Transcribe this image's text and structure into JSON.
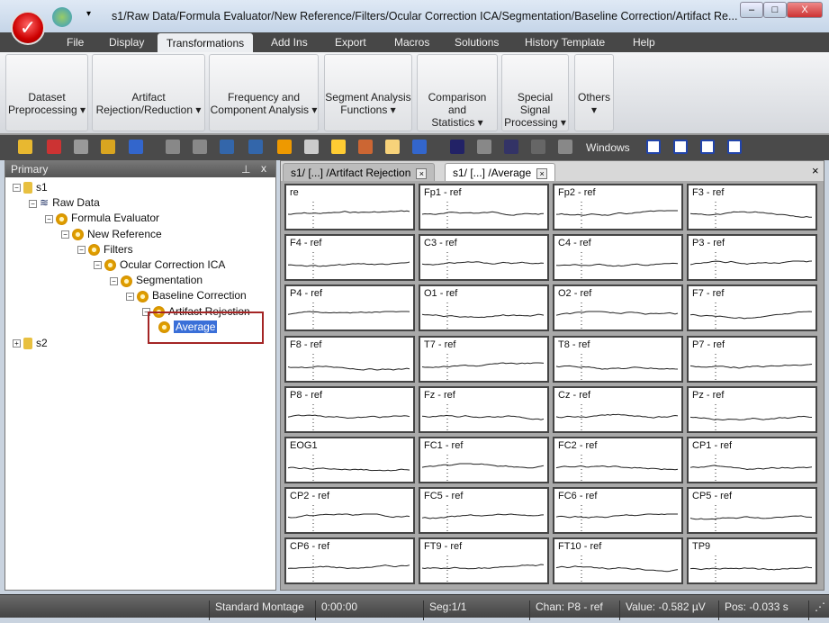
{
  "window": {
    "title": "s1/Raw Data/Formula Evaluator/New Reference/Filters/Ocular Correction ICA/Segmentation/Baseline Correction/Artifact Re...",
    "minimize": "–",
    "restore": "□",
    "close": "X"
  },
  "menu": [
    "File",
    "Display",
    "Transformations",
    "Add Ins",
    "Export",
    "Macros",
    "Solutions",
    "History Template",
    "Help"
  ],
  "active_menu": "Transformations",
  "ribbon": [
    {
      "l1": "Dataset",
      "l2": "Preprocessing ▾"
    },
    {
      "l1": "Artifact",
      "l2": "Rejection/Reduction ▾"
    },
    {
      "l1": "Frequency and",
      "l2": "Component Analysis ▾"
    },
    {
      "l1": "Segment Analysis",
      "l2": "Functions ▾"
    },
    {
      "l1": "Comparison and",
      "l2": "Statistics ▾"
    },
    {
      "l1": "Special Signal",
      "l2": "Processing ▾"
    },
    {
      "l1": "Others",
      "l2": "▾"
    }
  ],
  "toolbar": {
    "windows_label": "Windows"
  },
  "left_pane": {
    "title": "Primary",
    "pin": "⊥",
    "close": "x",
    "tree": [
      {
        "label": "s1",
        "level": 0,
        "icon": "folder-icon"
      },
      {
        "label": "Raw Data",
        "level": 1,
        "icon": "waves-icon"
      },
      {
        "label": "Formula Evaluator",
        "level": 2,
        "icon": "gear-icon"
      },
      {
        "label": "New Reference",
        "level": 3,
        "icon": "gear-icon"
      },
      {
        "label": "Filters",
        "level": 4,
        "icon": "gear-icon"
      },
      {
        "label": "Ocular Correction ICA",
        "level": 5,
        "icon": "gear-icon"
      },
      {
        "label": "Segmentation",
        "level": 6,
        "icon": "gear-icon"
      },
      {
        "label": "Baseline Correction",
        "level": 7,
        "icon": "gear-icon"
      },
      {
        "label": "Artifact Rejection",
        "level": 8,
        "icon": "gear-icon"
      },
      {
        "label": "Average",
        "level": 9,
        "icon": "gear-icon",
        "selected": true
      },
      {
        "label": "s2",
        "level": 0,
        "icon": "folder-icon"
      }
    ]
  },
  "doc_tabs": [
    {
      "label": "s1/ [...] /Artifact Rejection",
      "active": false
    },
    {
      "label": "s1/ [...] /Average",
      "active": true
    }
  ],
  "doc_close": "×",
  "channels": [
    "re",
    "Fp1 - ref",
    "Fp2 - ref",
    "F3 - ref",
    "F4 - ref",
    "C3 - ref",
    "C4 - ref",
    "P3 - ref",
    "P4 - ref",
    "O1 - ref",
    "O2 - ref",
    "F7 - ref",
    "F8 - ref",
    "T7 - ref",
    "T8 - ref",
    "P7 - ref",
    "P8 - ref",
    "Fz - ref",
    "Cz - ref",
    "Pz - ref",
    "EOG1",
    "FC1 - ref",
    "FC2 - ref",
    "CP1 - ref",
    "CP2 - ref",
    "FC5 - ref",
    "FC6 - ref",
    "CP5 - ref",
    "CP6 - ref",
    "FT9 - ref",
    "FT10 - ref",
    "TP9"
  ],
  "status": {
    "montage": "Standard Montage",
    "time": "0:00:00",
    "seg": "Seg:1/1",
    "chan": "Chan:  P8 - ref",
    "value": "Value: -0.582 µV",
    "pos": "Pos:  -0.033 s"
  },
  "colors": {
    "selected_bg": "#3a6fd8",
    "highlight_box": "#a42525",
    "toolbar": "#4a4a4a"
  }
}
